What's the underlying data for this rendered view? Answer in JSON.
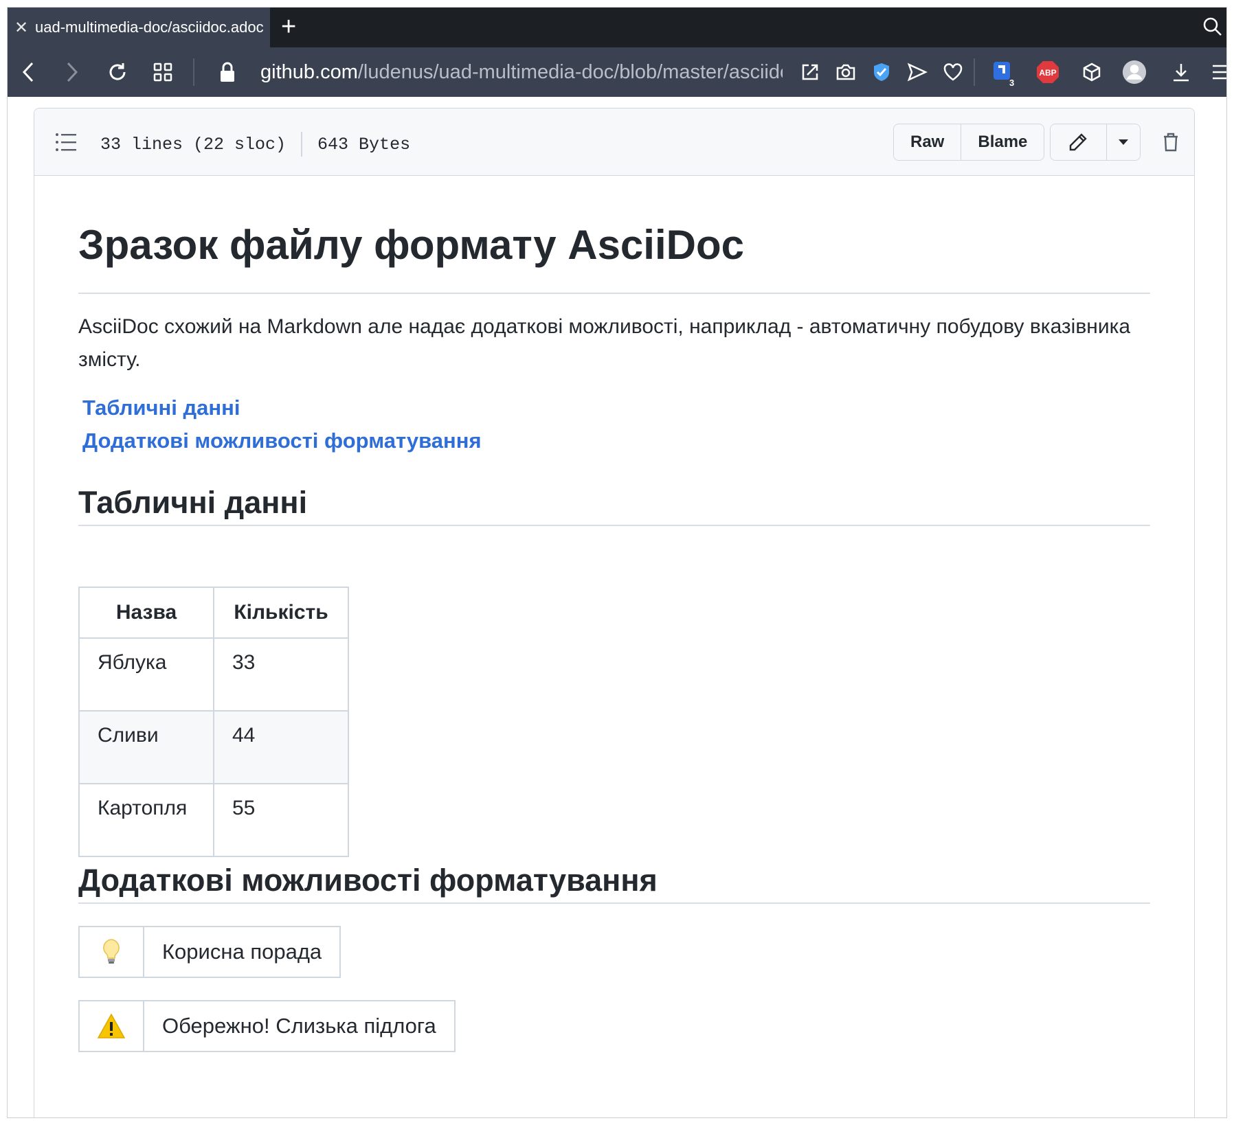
{
  "browser": {
    "tab": {
      "title": "uad-multimedia-doc/asciidoc.adoc",
      "close_icon": "close-icon"
    },
    "new_tab_icon": "plus-icon",
    "url": {
      "host": "github.com",
      "path": "/ludenus/uad-multimedia-doc/blob/master/asciidoc.adoc"
    },
    "extension_badge": "3",
    "abp_label": "ABP"
  },
  "file_header": {
    "lines": "33 lines (22 sloc)",
    "size": "643 Bytes",
    "raw_label": "Raw",
    "blame_label": "Blame"
  },
  "document": {
    "title": "Зразок файлу формату AsciiDoc",
    "intro": "AsciiDoc схожий на Markdown але надає додаткові можливості, наприклад - автоматичну побудову вказівника змісту.",
    "toc": [
      {
        "label": "Табличні данні"
      },
      {
        "label": "Додаткові можливості форматування"
      }
    ],
    "section_table": {
      "heading": "Табличні данні",
      "columns": [
        "Назва",
        "Кількість"
      ],
      "rows": [
        [
          "Яблука",
          "33"
        ],
        [
          "Сливи",
          "44"
        ],
        [
          "Картопля",
          "55"
        ]
      ]
    },
    "section_formatting": {
      "heading": "Додаткові можливості форматування",
      "tip": {
        "icon": "lightbulb-icon",
        "text": "Корисна порада"
      },
      "warning": {
        "icon": "warning-icon",
        "text": "Обережно! Слизька підлога"
      }
    }
  },
  "colors": {
    "link": "#2e6ed6",
    "border": "#d0d7de",
    "toolbar": "#3a4150"
  }
}
